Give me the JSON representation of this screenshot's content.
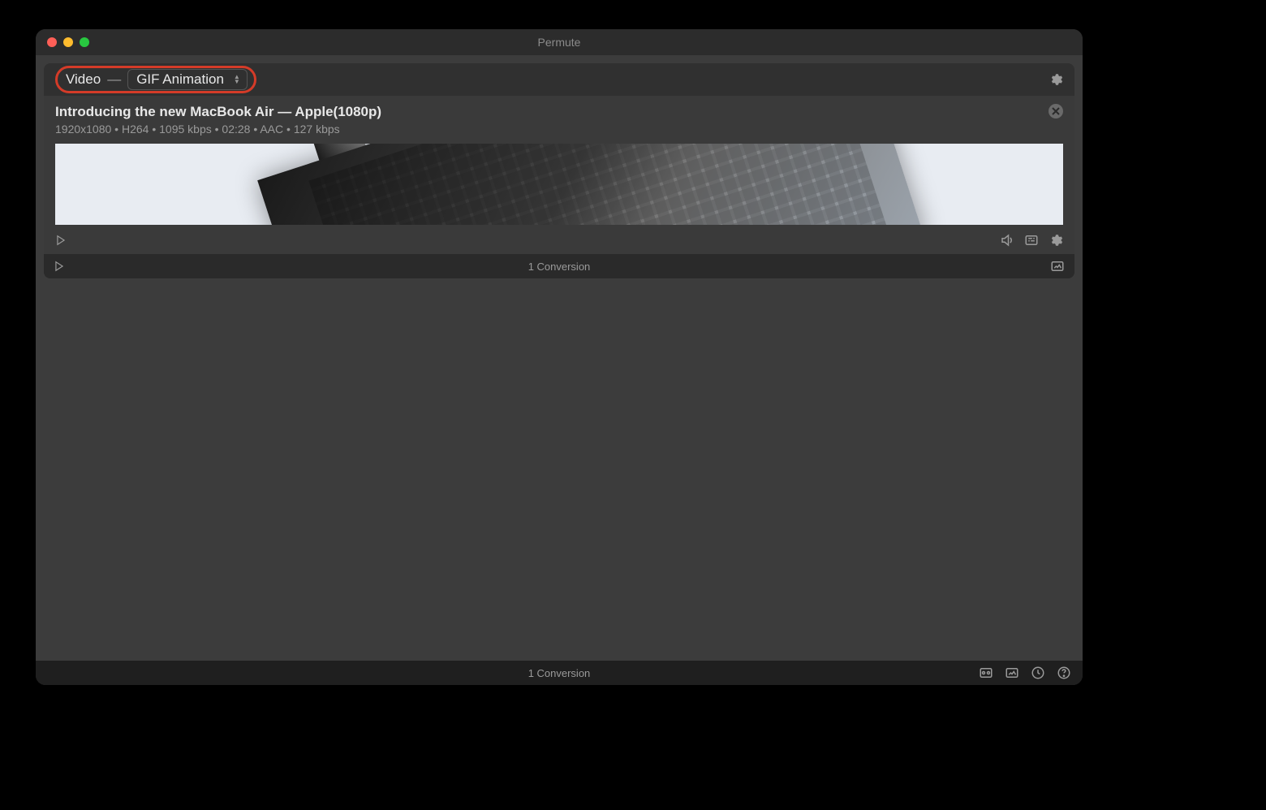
{
  "app": {
    "title": "Permute"
  },
  "group": {
    "category": "Video",
    "preset": "GIF Animation",
    "footer_label": "1 Conversion"
  },
  "file": {
    "title": "Introducing the new MacBook Air — Apple(1080p)",
    "meta": "1920x1080 • H264 • 1095 kbps • 02:28 • AAC • 127 kbps"
  },
  "statusbar": {
    "label": "1 Conversion"
  }
}
